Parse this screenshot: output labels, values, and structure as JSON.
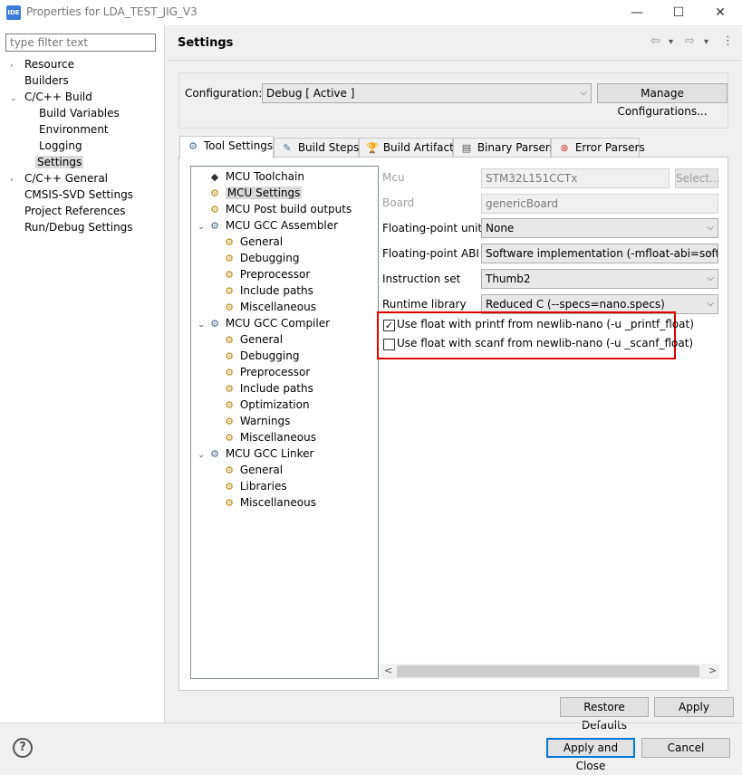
{
  "window": {
    "app_icon": "IDE",
    "title": "Properties for LDA_TEST_JIG_V3",
    "minimize": "—",
    "maximize": "☐",
    "close": "✕"
  },
  "filter": {
    "placeholder": "type filter text"
  },
  "nav": {
    "items": [
      {
        "label": "Resource",
        "arrow": "›"
      },
      {
        "label": "Builders",
        "arrow": ""
      },
      {
        "label": "C/C++ Build",
        "arrow": "⌄"
      },
      {
        "label": "Build Variables",
        "arrow": ""
      },
      {
        "label": "Environment",
        "arrow": ""
      },
      {
        "label": "Logging",
        "arrow": ""
      },
      {
        "label": "Settings",
        "arrow": ""
      },
      {
        "label": "C/C++ General",
        "arrow": "›"
      },
      {
        "label": "CMSIS-SVD Settings",
        "arrow": ""
      },
      {
        "label": "Project References",
        "arrow": ""
      },
      {
        "label": "Run/Debug Settings",
        "arrow": ""
      }
    ]
  },
  "header": {
    "title": "Settings",
    "back_icon": "⇦",
    "forward_icon": "⇨",
    "dropdown_icon": "▾",
    "menu_icon": "⋮"
  },
  "configuration": {
    "label": "Configuration:",
    "value": "Debug  [ Active ]",
    "manage_button": "Manage Configurations..."
  },
  "tabs": [
    {
      "label": "Tool Settings",
      "icon": "⚙"
    },
    {
      "label": "Build Steps",
      "icon": "✎"
    },
    {
      "label": "Build Artifact",
      "icon": "🏆"
    },
    {
      "label": "Binary Parsers",
      "icon": "▤"
    },
    {
      "label": "Error Parsers",
      "icon": "⊗"
    }
  ],
  "tree": {
    "items": [
      {
        "label": "MCU Toolchain",
        "arrow": "",
        "icon": "◆"
      },
      {
        "label": "MCU Settings",
        "arrow": "",
        "icon": "⚙"
      },
      {
        "label": "MCU Post build outputs",
        "arrow": "",
        "icon": "⚙"
      },
      {
        "label": "MCU GCC Assembler",
        "arrow": "⌄",
        "icon": "⚙"
      },
      {
        "label": "General",
        "arrow": "",
        "icon": "⚙"
      },
      {
        "label": "Debugging",
        "arrow": "",
        "icon": "⚙"
      },
      {
        "label": "Preprocessor",
        "arrow": "",
        "icon": "⚙"
      },
      {
        "label": "Include paths",
        "arrow": "",
        "icon": "⚙"
      },
      {
        "label": "Miscellaneous",
        "arrow": "",
        "icon": "⚙"
      },
      {
        "label": "MCU GCC Compiler",
        "arrow": "⌄",
        "icon": "⚙"
      },
      {
        "label": "General",
        "arrow": "",
        "icon": "⚙"
      },
      {
        "label": "Debugging",
        "arrow": "",
        "icon": "⚙"
      },
      {
        "label": "Preprocessor",
        "arrow": "",
        "icon": "⚙"
      },
      {
        "label": "Include paths",
        "arrow": "",
        "icon": "⚙"
      },
      {
        "label": "Optimization",
        "arrow": "",
        "icon": "⚙"
      },
      {
        "label": "Warnings",
        "arrow": "",
        "icon": "⚙"
      },
      {
        "label": "Miscellaneous",
        "arrow": "",
        "icon": "⚙"
      },
      {
        "label": "MCU GCC Linker",
        "arrow": "⌄",
        "icon": "⚙"
      },
      {
        "label": "General",
        "arrow": "",
        "icon": "⚙"
      },
      {
        "label": "Libraries",
        "arrow": "",
        "icon": "⚙"
      },
      {
        "label": "Miscellaneous",
        "arrow": "",
        "icon": "⚙"
      }
    ]
  },
  "form": {
    "mcu": {
      "label": "Mcu",
      "value": "STM32L151CCTx",
      "button": "Select..."
    },
    "board": {
      "label": "Board",
      "value": "genericBoard"
    },
    "fpu": {
      "label": "Floating-point unit",
      "value": "None"
    },
    "fpabi": {
      "label": "Floating-point ABI",
      "value": "Software implementation (-mfloat-abi=soft)"
    },
    "iset": {
      "label": "Instruction set",
      "value": "Thumb2"
    },
    "runtime": {
      "label": "Runtime library",
      "value": "Reduced C (--specs=nano.specs)"
    },
    "printf_float": {
      "label": "Use float with printf from newlib-nano (-u _printf_float)",
      "mark": "✓"
    },
    "scanf_float": {
      "label": "Use float with scanf from newlib-nano (-u _scanf_float)",
      "mark": ""
    },
    "scroll_left": "<",
    "scroll_right": ">"
  },
  "buttons": {
    "restore_defaults": "Restore Defaults",
    "apply": "Apply",
    "apply_close": "Apply and Close",
    "cancel": "Cancel"
  },
  "help": {
    "icon": "?"
  },
  "colors": {
    "highlight": "#e00000",
    "accent": "#0078d7"
  }
}
